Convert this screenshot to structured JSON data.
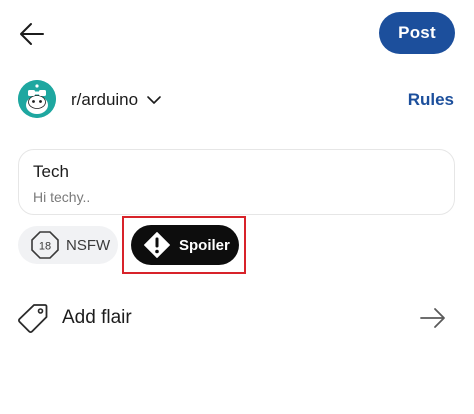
{
  "header": {
    "post_label": "Post"
  },
  "community": {
    "name": "r/arduino",
    "rules_label": "Rules"
  },
  "post": {
    "title": "Tech",
    "body": "Hi techy.."
  },
  "tags": {
    "nsfw_label": "NSFW",
    "nsfw_icon_text": "18",
    "spoiler_label": "Spoiler"
  },
  "flair": {
    "label": "Add flair"
  },
  "colors": {
    "accent": "#1c4f9c",
    "avatar_bg": "#1ea7a0",
    "highlight_border": "#d8232a",
    "spoiler_bg": "#0d0d0d"
  },
  "icons": {
    "back": "arrow-left-icon",
    "community_caret": "chevron-down-icon",
    "nsfw": "nsfw-18-icon",
    "spoiler": "exclamation-diamond-icon",
    "flair": "tag-icon",
    "flair_arrow": "arrow-right-icon"
  }
}
